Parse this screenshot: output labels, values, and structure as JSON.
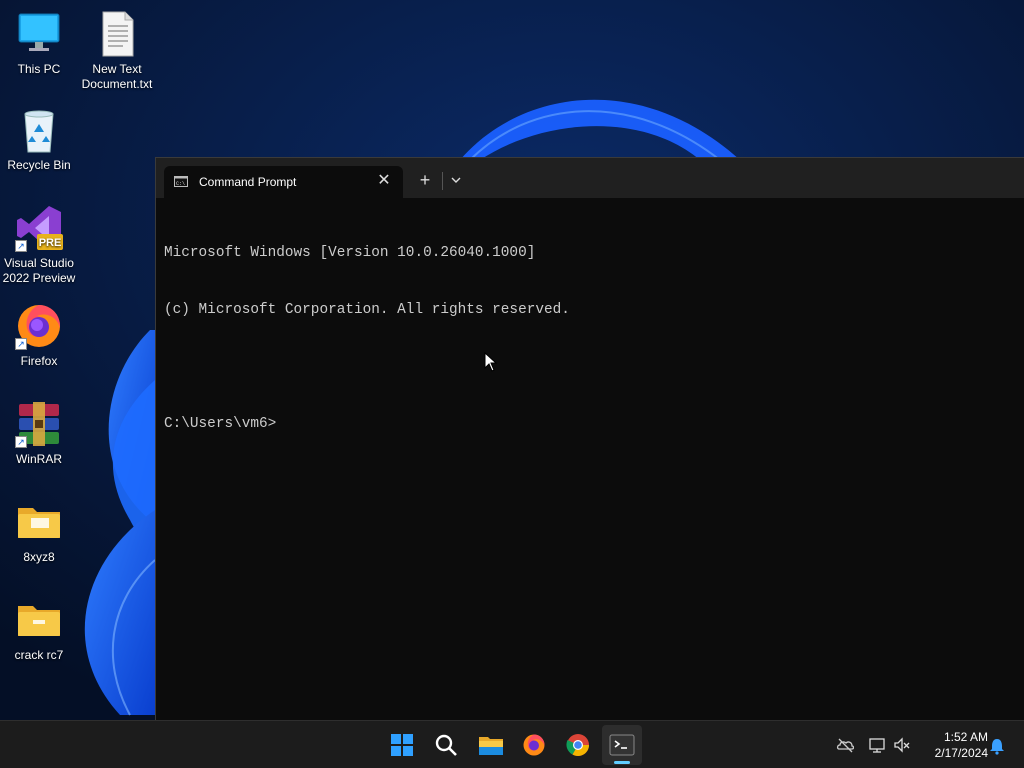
{
  "desktop": {
    "icons": [
      {
        "label": "This PC",
        "icon": "monitor-icon"
      },
      {
        "label": "New Text\nDocument.txt",
        "icon": "text-file-icon"
      },
      {
        "label": "Recycle Bin",
        "icon": "recycle-bin-icon"
      },
      {
        "label": "Visual Studio\n2022 Preview",
        "icon": "visual-studio-icon",
        "badge": "PRE"
      },
      {
        "label": "Firefox",
        "icon": "firefox-icon"
      },
      {
        "label": "WinRAR",
        "icon": "winrar-icon"
      },
      {
        "label": "8xyz8",
        "icon": "folder-icon"
      },
      {
        "label": "crack rc7",
        "icon": "folder-icon"
      }
    ]
  },
  "terminal": {
    "tab_title": "Command Prompt",
    "tab_icon": "cmd-icon",
    "new_tab_label": "+",
    "close_label": "✕",
    "lines": [
      "Microsoft Windows [Version 10.0.26040.1000]",
      "(c) Microsoft Corporation. All rights reserved.",
      "",
      "C:\\Users\\vm6>"
    ]
  },
  "taskbar": {
    "apps": [
      "start-icon",
      "search-icon",
      "file-explorer-icon",
      "firefox-icon",
      "chrome-icon",
      "terminal-icon"
    ],
    "active_app": "terminal-icon",
    "tray": [
      "onedrive-offline-icon",
      "network-icon",
      "volume-muted-icon"
    ],
    "time": "1:52 AM",
    "date": "2/17/2024",
    "notification_icon": "bell-icon"
  },
  "colors": {
    "accent": "#60cdff",
    "terminal_bg": "#0c0c0c",
    "console_text": "#cccccc",
    "taskbar_bg": "#1c1c1c"
  }
}
